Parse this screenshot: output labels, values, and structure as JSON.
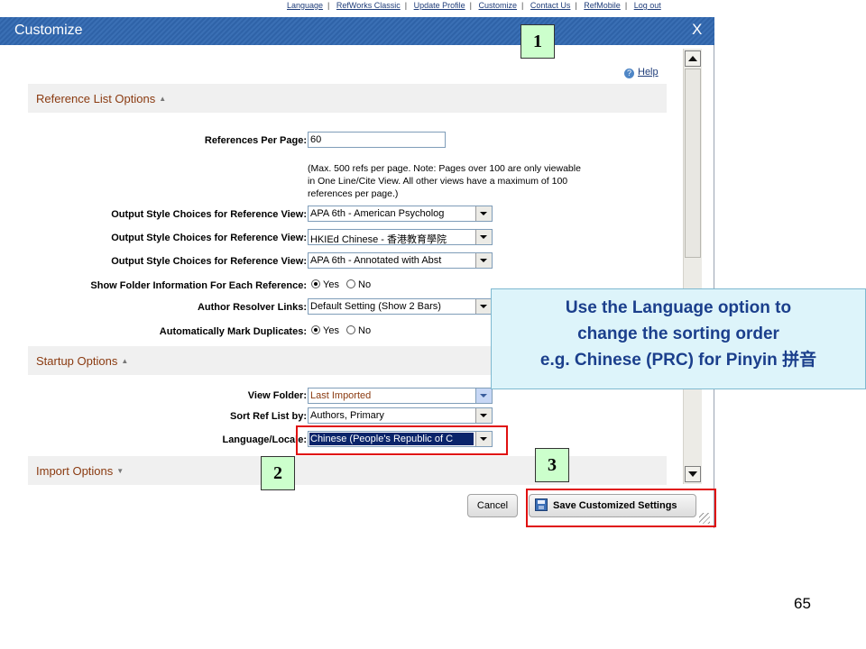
{
  "toplinks": [
    "Language",
    "RefWorks Classic",
    "Update Profile",
    "Customize",
    "Contact Us",
    "RefMobile",
    "Log out"
  ],
  "dialog": {
    "title": "Customize",
    "close": "X",
    "help": "Help",
    "help_icon": "question-icon"
  },
  "reference_list": {
    "header": "Reference List Options",
    "refs_per_page_label": "References Per Page:",
    "refs_per_page_value": "60",
    "note": "(Max. 500 refs per page. Note: Pages over 100 are only viewable in One Line/Cite View. All other views have a maximum of 100 references per page.)",
    "output_style_label": "Output Style Choices for Reference View:",
    "output_styles": [
      "APA 6th - American Psycholog",
      "HKIEd Chinese - 香港教育學院",
      "APA 6th - Annotated with Abst"
    ],
    "folder_info_label": "Show Folder Information For Each Reference:",
    "author_resolver_label": "Author Resolver Links:",
    "author_resolver_value": "Default Setting (Show 2 Bars)",
    "mark_duplicates_label": "Automatically Mark Duplicates:",
    "yes": "Yes",
    "no": "No"
  },
  "startup": {
    "header": "Startup Options",
    "view_folder_label": "View Folder:",
    "view_folder_value": "Last Imported",
    "sort_label": "Sort Ref List by:",
    "sort_value": "Authors, Primary",
    "language_label": "Language/Locale:",
    "language_value": "Chinese (People's Republic of C"
  },
  "import": {
    "header": "Import Options"
  },
  "buttons": {
    "cancel": "Cancel",
    "save": "Save Customized Settings"
  },
  "callout": {
    "line1": "Use the Language option to",
    "line2": "change the sorting order",
    "line3": "e.g. Chinese (PRC) for Pinyin 拼音"
  },
  "markers": [
    "1",
    "2",
    "3"
  ],
  "page_number": "65",
  "colors": {
    "title_bar": "#2f63a8",
    "section_text": "#8a3a10",
    "callout_bg": "#ddf4fa",
    "marker_bg": "#ccffcc",
    "highlight": "#e01010"
  }
}
